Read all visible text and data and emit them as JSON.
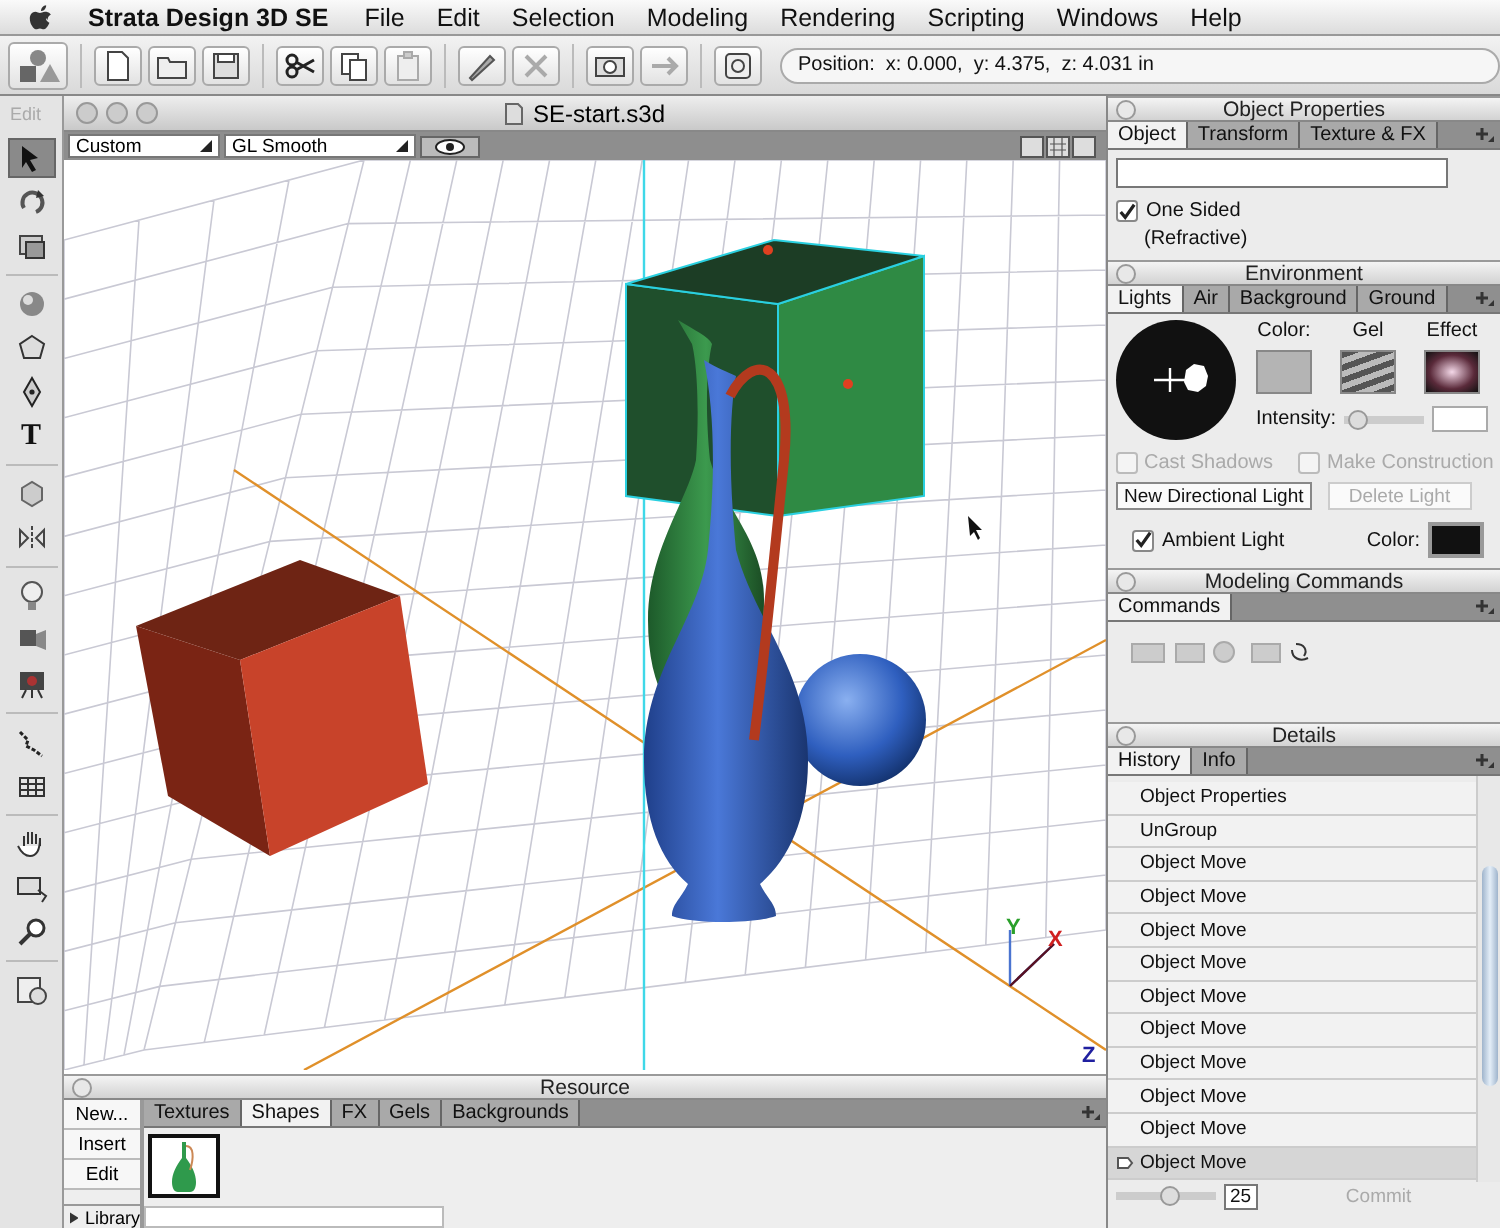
{
  "menubar": {
    "app": "Strata Design 3D SE",
    "menus": [
      "File",
      "Edit",
      "Selection",
      "Modeling",
      "Rendering",
      "Scripting",
      "Windows",
      "Help"
    ]
  },
  "toolbar": {
    "position": "Position:  x: 0.000,  y: 4.375,  z: 4.031 in"
  },
  "tool_palette": {
    "label": "Edit",
    "tools": [
      {
        "kind": "select",
        "selected": true
      },
      {
        "kind": "rotate",
        "selected": false
      },
      {
        "kind": "frame",
        "selected": false
      },
      {
        "kind": "sphere",
        "selected": false
      },
      {
        "kind": "polygon",
        "selected": false
      },
      {
        "kind": "pen",
        "selected": false
      },
      {
        "kind": "text",
        "glyph": "T",
        "selected": false
      },
      {
        "kind": "extrude",
        "selected": false
      },
      {
        "kind": "mirror",
        "selected": false
      },
      {
        "kind": "bulb",
        "selected": false
      },
      {
        "kind": "spotlight",
        "selected": false
      },
      {
        "kind": "camera",
        "selected": false
      },
      {
        "kind": "path",
        "selected": false
      },
      {
        "kind": "grid",
        "selected": false
      },
      {
        "kind": "hand",
        "selected": false
      },
      {
        "kind": "render",
        "selected": false
      },
      {
        "kind": "zoom",
        "selected": false
      },
      {
        "kind": "snapshot",
        "selected": false
      }
    ]
  },
  "document": {
    "title": "SE-start.s3d",
    "camera": "Custom",
    "render_mode": "GL Smooth",
    "axis_labels": {
      "y": "Y",
      "x": "X",
      "z": "Z"
    }
  },
  "object_properties": {
    "title": "Object Properties",
    "tabs": [
      {
        "label": "Object",
        "selected": true
      },
      {
        "label": "Transform",
        "selected": false
      },
      {
        "label": "Texture & FX",
        "selected": false
      }
    ],
    "one_sided": {
      "label": "One Sided",
      "checked": true
    },
    "note": "(Refractive)"
  },
  "environment": {
    "title": "Environment",
    "tabs": [
      {
        "label": "Lights",
        "selected": true
      },
      {
        "label": "Air",
        "selected": false
      },
      {
        "label": "Background",
        "selected": false
      },
      {
        "label": "Ground",
        "selected": false
      }
    ],
    "color_label": "Color:",
    "gel_label": "Gel",
    "effect_label": "Effect",
    "intensity_label": "Intensity:",
    "intensity": {
      "level": 0.05
    },
    "cast_shadows": {
      "label": "Cast Shadows",
      "checked": false,
      "disabled": true
    },
    "make_construction": {
      "label": "Make Construction",
      "checked": false,
      "disabled": true
    },
    "new_light": {
      "label": "New Directional Light",
      "disabled": false
    },
    "delete_light": {
      "label": "Delete Light",
      "disabled": true
    },
    "ambient": {
      "label": "Ambient Light",
      "checked": true
    },
    "ambient_color_label": "Color:"
  },
  "modeling_commands": {
    "title": "Modeling Commands",
    "tabs": [
      {
        "label": "Commands",
        "selected": true
      }
    ]
  },
  "details": {
    "title": "Details",
    "tabs": [
      {
        "label": "History",
        "selected": true
      },
      {
        "label": "Info",
        "selected": false
      }
    ],
    "history": [
      {
        "label": "Object Properties",
        "selected": false
      },
      {
        "label": "UnGroup",
        "selected": false
      },
      {
        "label": "Object Move",
        "selected": false
      },
      {
        "label": "Object Move",
        "selected": false
      },
      {
        "label": "Object Move",
        "selected": false
      },
      {
        "label": "Object Move",
        "selected": false
      },
      {
        "label": "Object Move",
        "selected": false
      },
      {
        "label": "Object Move",
        "selected": false
      },
      {
        "label": "Object Move",
        "selected": false
      },
      {
        "label": "Object Move",
        "selected": false
      },
      {
        "label": "Object Move",
        "selected": false
      },
      {
        "label": "Object Move",
        "selected": true
      }
    ],
    "undo_slider": {
      "level": 0.55
    },
    "steps": "25",
    "commit": {
      "label": "Commit",
      "disabled": true
    }
  },
  "resource": {
    "title": "Resource",
    "buttons": [
      "New...",
      "Insert",
      "Edit"
    ],
    "library": "Library",
    "tabs": [
      {
        "label": "Textures",
        "selected": false
      },
      {
        "label": "Shapes",
        "selected": true
      },
      {
        "label": "FX",
        "selected": false
      },
      {
        "label": "Gels",
        "selected": false
      },
      {
        "label": "Backgrounds",
        "selected": false
      }
    ]
  }
}
